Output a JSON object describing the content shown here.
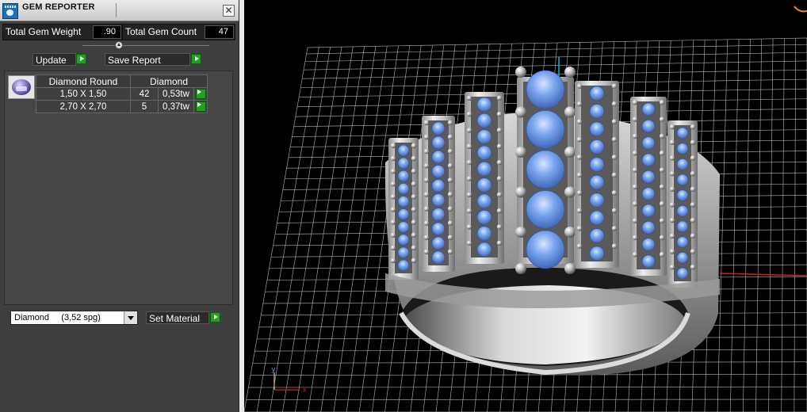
{
  "window": {
    "title": "GEM REPORTER",
    "close_glyph": "✕"
  },
  "summary": {
    "total_weight_label": "Total Gem Weight",
    "total_weight_value": ".90",
    "total_count_label": "Total Gem Count",
    "total_count_value": "47"
  },
  "buttons": {
    "update": "Update",
    "save_report": "Save Report",
    "set_material": "Set Material"
  },
  "gem_table": {
    "columns": [
      "Diamond Round",
      "Diamond"
    ],
    "rows": [
      {
        "size": "1,50 X 1,50",
        "count": "42",
        "weight": "0,53tw"
      },
      {
        "size": "2,70 X 2,70",
        "count": "5",
        "weight": "0,37tw"
      }
    ]
  },
  "material": {
    "selected": "Diamond     (3,52 spg)"
  },
  "viewport": {
    "axis_labels": [
      "x",
      "y"
    ]
  },
  "colors": {
    "panel_bg": "#3e3e3e",
    "accent_green": "#1fa21f",
    "gem_blue": "#6f9de8",
    "metal": "#c8c8c8",
    "grid_line": "#cfcfcf",
    "axis_red": "#cc2222",
    "axis_cyan": "#19b5c8"
  },
  "icons": {
    "app": "gem-reporter-icon",
    "close": "close-icon",
    "play": "play-arrow-icon",
    "dropdown": "chevron-down-icon",
    "gem": "diamond-thumbnail-icon"
  }
}
